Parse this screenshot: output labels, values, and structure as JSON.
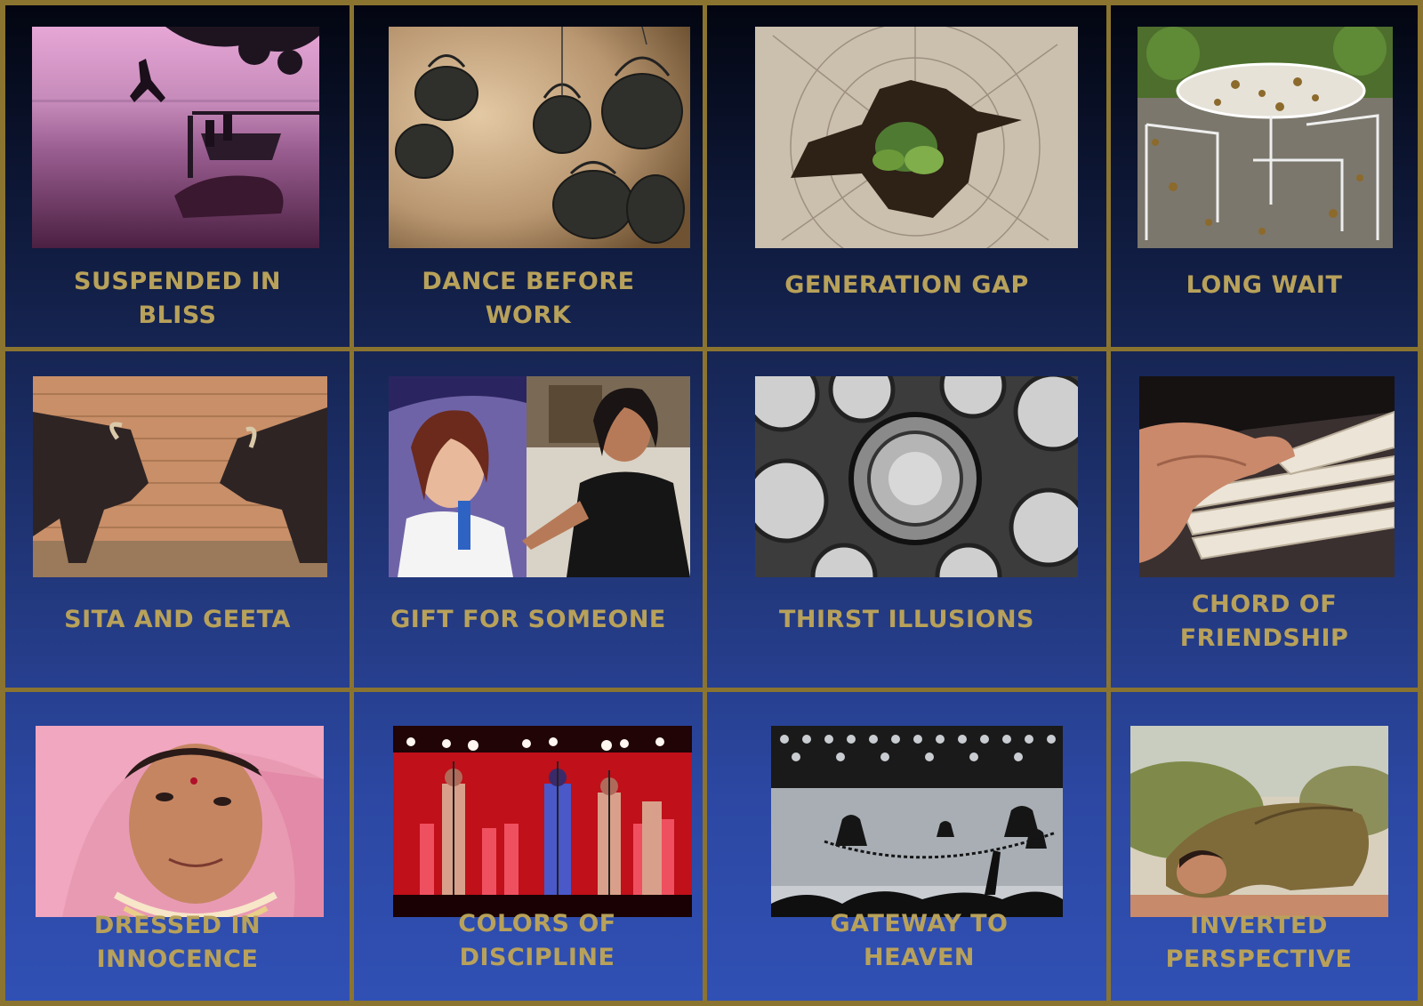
{
  "tiles": [
    {
      "caption": "SUSPENDED IN\nBLISS",
      "image": "photo-jump-into-river"
    },
    {
      "caption": "DANCE BEFORE\nWORK",
      "image": "photo-hanging-kettles"
    },
    {
      "caption": "GENERATION GAP",
      "image": "photo-sprout-in-tree-stump"
    },
    {
      "caption": "LONG WAIT",
      "image": "photo-table-covered-in-leaves"
    },
    {
      "caption": "SITA AND GEETA",
      "image": "photo-two-buffaloes"
    },
    {
      "caption": "GIFT FOR SOMEONE",
      "image": "photo-woman-and-poster"
    },
    {
      "caption": "THIRST ILLUSIONS",
      "image": "photo-glasses-from-above"
    },
    {
      "caption": "CHORD OF\nFRIENDSHIP",
      "image": "photo-hand-on-piano"
    },
    {
      "caption": "DRESSED IN\nINNOCENCE",
      "image": "photo-girl-in-pink-veil"
    },
    {
      "caption": "COLORS OF\nDISCIPLINE",
      "image": "photo-red-stage-performance"
    },
    {
      "caption": "GATEWAY TO\nHEAVEN",
      "image": "photo-temple-bells-silhouette"
    },
    {
      "caption": "INVERTED\nPERSPECTIVE",
      "image": "photo-yoga-pose"
    }
  ],
  "colors": {
    "frame": "#8a7430",
    "caption": "#b8a15a",
    "background_top": "#030611",
    "background_bottom": "#3050b4"
  }
}
